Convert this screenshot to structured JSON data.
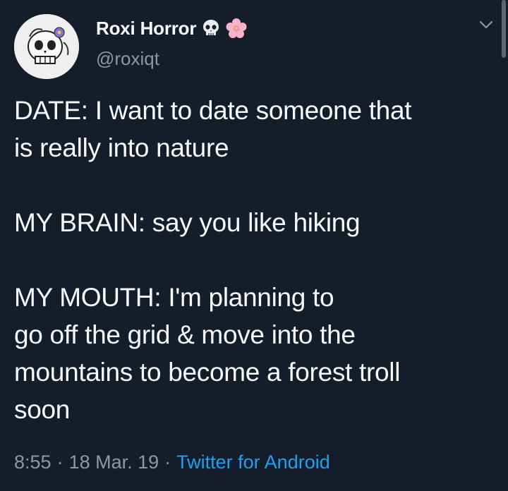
{
  "user": {
    "display_name": "Roxi Horror",
    "handle": "@roxiqt",
    "name_emojis": [
      "skull-icon",
      "cherry-blossom-icon"
    ],
    "avatar": "skull-avatar"
  },
  "tweet": {
    "lines_block1": [
      "DATE: I want to date someone that",
      "is really into nature"
    ],
    "lines_block2": [
      "MY BRAIN: say you like hiking"
    ],
    "lines_block3": [
      "MY MOUTH: I'm planning to",
      "go off the grid & move into the",
      "mountains to become a forest troll",
      "soon"
    ]
  },
  "meta": {
    "time": "8:55",
    "date": "18 Mar. 19",
    "separator": "·",
    "source": "Twitter for Android"
  },
  "colors": {
    "background": "#161d2a",
    "text": "#f7f9fa",
    "secondary_text": "#8b98a5",
    "link": "#1da1f2"
  },
  "icons": {
    "menu": "chevron-down-icon"
  }
}
